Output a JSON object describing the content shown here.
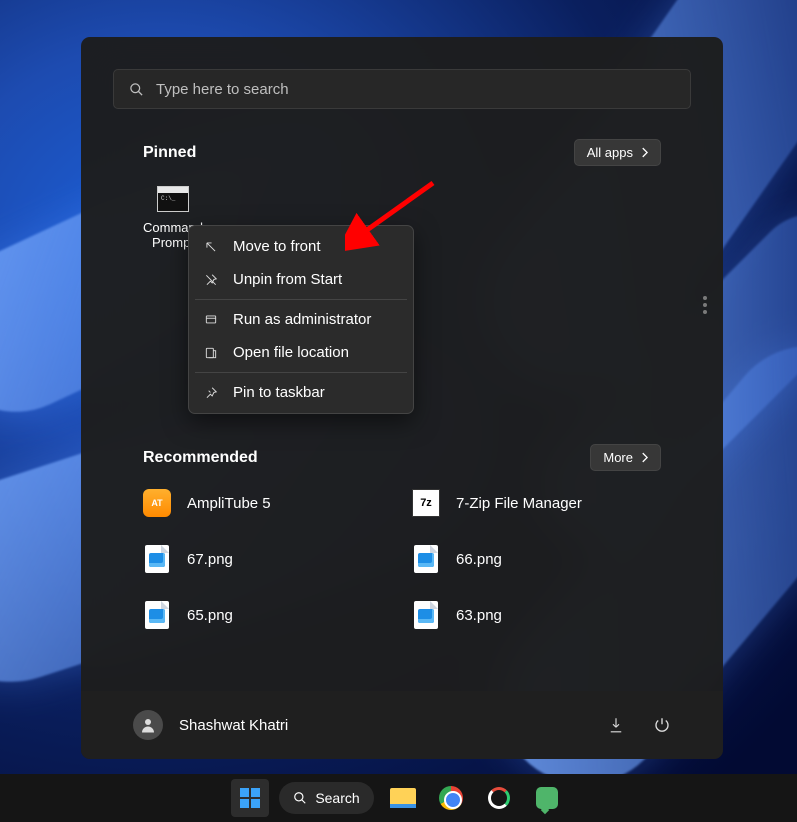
{
  "search": {
    "placeholder": "Type here to search"
  },
  "pinned": {
    "title": "Pinned",
    "allAppsLabel": "All apps",
    "items": [
      {
        "label": "Command Prompt"
      }
    ]
  },
  "contextMenu": {
    "items": [
      {
        "label": "Move to front"
      },
      {
        "label": "Unpin from Start"
      },
      {
        "label": "Run as administrator"
      },
      {
        "label": "Open file location"
      },
      {
        "label": "Pin to taskbar"
      }
    ]
  },
  "recommended": {
    "title": "Recommended",
    "moreLabel": "More",
    "items": [
      {
        "label": "AmpliTube 5"
      },
      {
        "label": "7-Zip File Manager"
      },
      {
        "label": "67.png"
      },
      {
        "label": "66.png"
      },
      {
        "label": "65.png"
      },
      {
        "label": "63.png"
      }
    ]
  },
  "footer": {
    "username": "Shashwat Khatri"
  },
  "taskbar": {
    "searchLabel": "Search"
  }
}
